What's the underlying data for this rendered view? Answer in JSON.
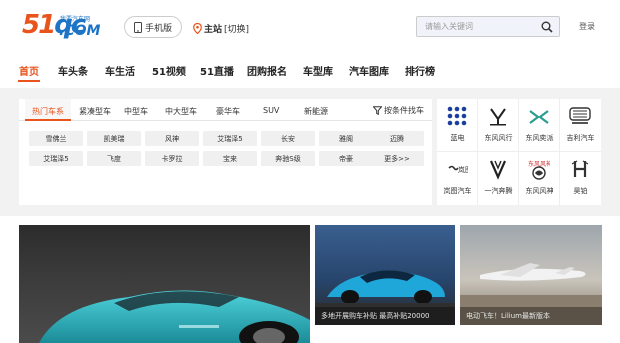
{
  "header": {
    "logo_main": "51",
    "logo_main2": "qc",
    "logo_sub": "我要汽车网",
    "logo_com": ".COM",
    "mobile_label": "手机版",
    "site_current": "主站",
    "site_switch": "[切换]",
    "search_placeholder": "请输入关键词",
    "login_label": "登录"
  },
  "nav": {
    "items": [
      "首页",
      "车头条",
      "车生活",
      "51视频",
      "51直播",
      "团购报名",
      "车型库",
      "汽车图库",
      "排行榜"
    ]
  },
  "car_panel": {
    "tabs": [
      "热门车系",
      "紧凑型车",
      "中型车",
      "中大型车",
      "豪华车",
      "SUV",
      "新能源"
    ],
    "filter_label": "按条件找车",
    "rows": [
      [
        "雪佛兰",
        "凯美瑞",
        "风神",
        "艾瑞泽5",
        "长安",
        "雅阁",
        "迈腾"
      ],
      [
        "艾瑞泽5",
        "飞度",
        "卡罗拉",
        "宝来",
        "奔驰S级",
        "帝豪",
        "更多>>"
      ]
    ]
  },
  "brands": {
    "items": [
      "蓝电",
      "东风风行",
      "东风奕派",
      "吉利汽车",
      "岚图汽车",
      "一汽奔腾",
      "东风风神",
      "昊铂"
    ]
  },
  "news": {
    "captions": [
      "多地开展购车补贴 最高补贴20000",
      "电动飞车！Lilium最新版本"
    ]
  },
  "colors": {
    "accent": "#e8541c",
    "brand_blue": "#1d74c6",
    "band_gray": "#f2f2f2"
  }
}
